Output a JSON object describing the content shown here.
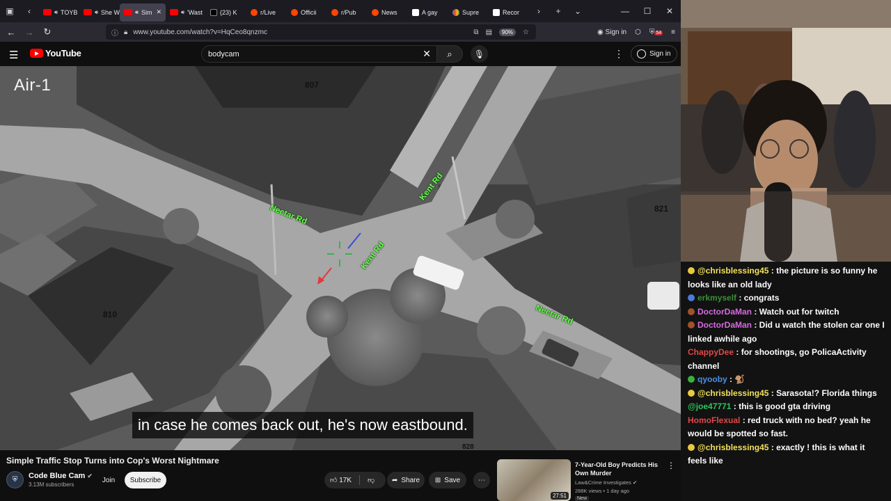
{
  "browser": {
    "tabs": [
      {
        "label": "TOYB",
        "favicon": "youtube",
        "active": false
      },
      {
        "label": "She W",
        "favicon": "youtube",
        "active": false
      },
      {
        "label": "Sim",
        "favicon": "youtube",
        "active": true
      },
      {
        "label": "'Wast",
        "favicon": "youtube",
        "active": false
      },
      {
        "label": "(23) K",
        "favicon": "x",
        "active": false
      },
      {
        "label": "r/Live",
        "favicon": "reddit",
        "active": false
      },
      {
        "label": "Officii",
        "favicon": "reddit",
        "active": false
      },
      {
        "label": "r/Pub",
        "favicon": "reddit",
        "active": false
      },
      {
        "label": "News",
        "favicon": "reddit",
        "active": false
      },
      {
        "label": "A gay",
        "favicon": "ap",
        "active": false
      },
      {
        "label": "Supre",
        "favicon": "google",
        "active": false
      },
      {
        "label": "Recor",
        "favicon": "ap",
        "active": false
      }
    ],
    "url": "www.youtube.com/watch?v=HqCeo8qnzmc",
    "zoom": "90%",
    "sign_in": "Sign in",
    "extension_badge": "54"
  },
  "youtube": {
    "logo_text": "YouTube",
    "search_value": "bodycam",
    "sign_in": "Sign in"
  },
  "video": {
    "overlay_title": "Air-1",
    "house_numbers": [
      "807",
      "821",
      "810",
      "828"
    ],
    "road_labels": [
      "Nectar Rd",
      "Kent Rd",
      "Kent Rd",
      "Nectar Rd"
    ],
    "subtitle": "in case he comes back out, he's now eastbound."
  },
  "meta": {
    "title": "Simple Traffic Stop Turns into Cop's Worst Nightmare",
    "channel": "Code Blue Cam",
    "subscribers": "3.13M subscribers",
    "join": "Join",
    "subscribe": "Subscribe",
    "likes": "17K",
    "share": "Share",
    "save": "Save"
  },
  "recommended": {
    "title": "7-Year-Old Boy Predicts His Own Murder",
    "channel": "Law&Crime Investigates",
    "meta": "288K views • 1 day ago",
    "badge": "New",
    "duration": "27:51"
  },
  "chat": [
    {
      "user": "@chrisblessing45",
      "color": "#f0e05a",
      "badge": "#e8c840",
      "text": " : the picture is so funny he looks like an old lady"
    },
    {
      "user": "erkmyself",
      "color": "#3a8f3a",
      "badge": "#4a7bd8",
      "text": " : congrats"
    },
    {
      "user": "DoctorDaMan",
      "color": "#d56be0",
      "badge": "#a0522d",
      "text": " : Watch out for twitch"
    },
    {
      "user": "DoctorDaMan",
      "color": "#d56be0",
      "badge": "#a0522d",
      "text": " : Did u watch the stolen car one I linked awhile ago"
    },
    {
      "user": "ChappyDee",
      "color": "#e04848",
      "badge": "",
      "text": " : for shootings, go PolicaActivity channel"
    },
    {
      "user": "qyooby",
      "color": "#4a90e2",
      "badge": "#3ab03a",
      "text": " : 🐒"
    },
    {
      "user": "@chrisblessing45",
      "color": "#f0e05a",
      "badge": "#e8c840",
      "text": " : Sarasota!? Florida things"
    },
    {
      "user": "@joe47771",
      "color": "#2ec55c",
      "badge": "",
      "text": " : this is good gta driving"
    },
    {
      "user": "HomoFlexual",
      "color": "#e04848",
      "badge": "",
      "text": " : red truck with no bed? yeah he would be spotted so fast."
    },
    {
      "user": "@chrisblessing45",
      "color": "#f0e05a",
      "badge": "#e8c840",
      "text": " : exactly ! this is what it feels like"
    }
  ]
}
